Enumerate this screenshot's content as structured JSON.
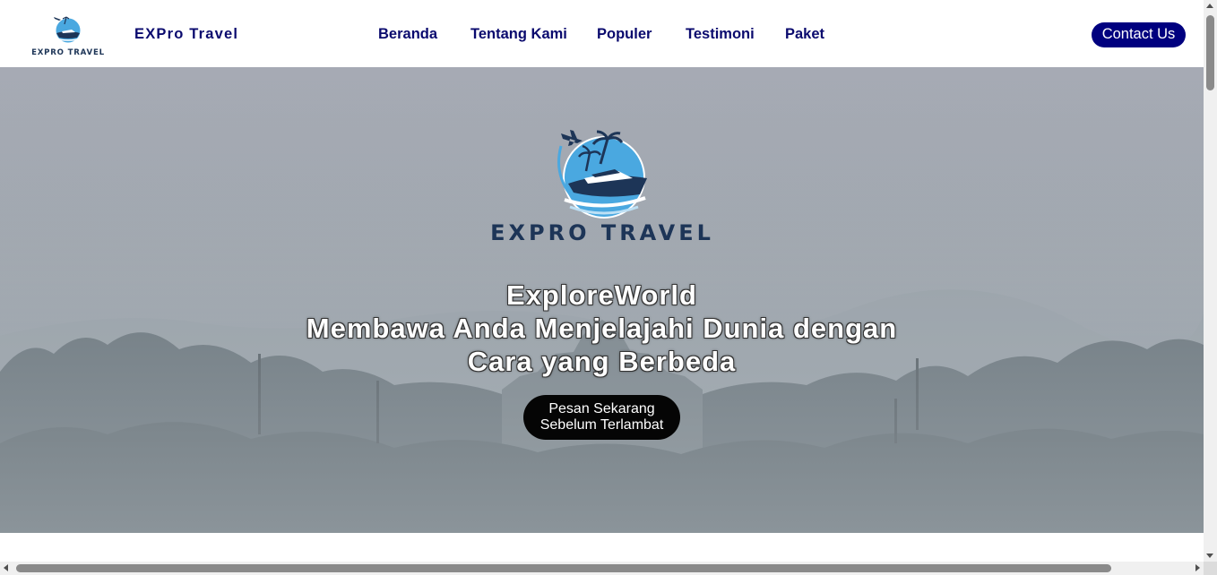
{
  "navbar": {
    "logo_text": "EXPRO TRAVEL",
    "brand": "EXPro Travel",
    "links": [
      {
        "label": "Beranda"
      },
      {
        "label": "Tentang Kami"
      },
      {
        "label": "Populer"
      },
      {
        "label": "Testimoni"
      },
      {
        "label": "Paket"
      }
    ],
    "contact_label": "Contact Us"
  },
  "hero": {
    "logo_text": "EXPRO TRAVEL",
    "heading_lines": [
      "ExploreWorld",
      "Membawa Anda Menjelajahi Dunia dengan",
      "Cara yang Berbeda"
    ],
    "cta_lines": [
      "Pesan Sekarang",
      "Sebelum Terlambat"
    ]
  },
  "colors": {
    "nav_text": "#0a0a6e",
    "contact_bg": "#00007f",
    "cta_bg": "#050505",
    "logo_text": "#1d3557",
    "logo_sky": "#4aa8e0"
  },
  "icons": {
    "logo": "boat-palm-plane-logo-icon"
  }
}
